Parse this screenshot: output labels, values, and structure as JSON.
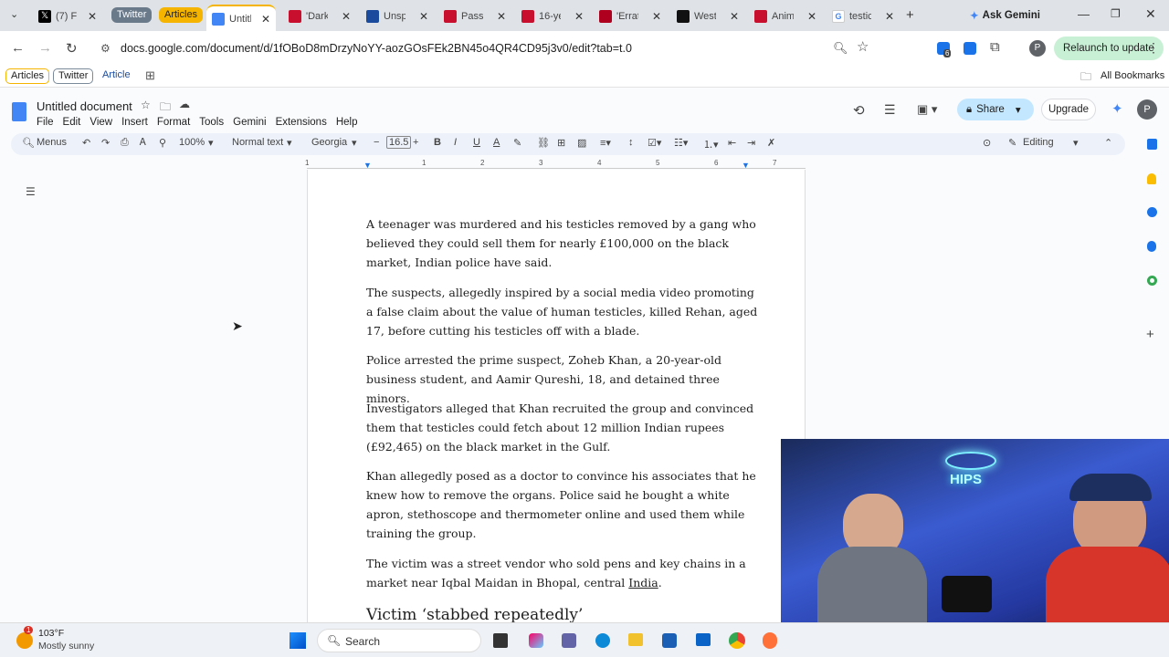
{
  "tabs": [
    {
      "title": "(7) Fr",
      "color": "#000000"
    },
    {
      "title": "Untitl",
      "color": "#4285f4",
      "active": true
    },
    {
      "title": "'Dark",
      "color": "#c8102e"
    },
    {
      "title": "Unsp",
      "color": "#1a4b9c"
    },
    {
      "title": "Passe",
      "color": "#c8102e"
    },
    {
      "title": "16-ye",
      "color": "#c8102e"
    },
    {
      "title": "'Errat",
      "color": "#b00020"
    },
    {
      "title": "West",
      "color": "#111111"
    },
    {
      "title": "Anim",
      "color": "#c8102e"
    },
    {
      "title": "testic",
      "color": "#ffffff"
    }
  ],
  "tab_groups": {
    "twitter": "Twitter",
    "articles": "Articles"
  },
  "ask_gemini": "Ask Gemini",
  "url": "docs.google.com/document/d/1fOBoD8mDrzyNoYY-aozGOsFEk2BN45o4QR4CD95j3v0/edit?tab=t.0",
  "extension_badge": "6",
  "relaunch": "Relaunch to update",
  "bookmarks": {
    "articles": "Articles",
    "twitter": "Twitter",
    "article": "Article",
    "all": "All Bookmarks"
  },
  "doc": {
    "title": "Untitled document",
    "menus": [
      "File",
      "Edit",
      "View",
      "Insert",
      "Format",
      "Tools",
      "Gemini",
      "Extensions",
      "Help"
    ],
    "share": "Share",
    "upgrade": "Upgrade",
    "avatar": "P"
  },
  "toolbar": {
    "menus": "Menus",
    "zoom": "100%",
    "style": "Normal text",
    "font": "Georgia",
    "font_size": "16.5",
    "mode": "Editing"
  },
  "ruler": [
    "1",
    "1",
    "2",
    "3",
    "4",
    "5",
    "6",
    "7"
  ],
  "paragraphs": [
    "A teenager was murdered and his testicles removed by a gang who believed they could sell them for nearly £100,000 on the black market, Indian police have said.",
    "The suspects, allegedly inspired by a social media video promoting a false claim about the value of human testicles, killed Rehan, aged 17, before cutting his testicles off with a blade.",
    "Police arrested the prime suspect, Zoheb Khan, a 20-year-old business student, and Aamir Qureshi, 18, and detained three minors.",
    "Investigators alleged that Khan recruited the group and convinced them that testicles could fetch about 12 million Indian rupees (£92,465) on the black market in the Gulf.",
    "Khan allegedly posed as a doctor to convince his associates that he knew how to remove the organs. Police said he bought a white apron, stethoscope and thermometer online and used them while training the group."
  ],
  "para6_text": "The victim was a street vendor who sold pens and key chains in a market near Iqbal Maidan in Bhopal, central ",
  "para6_link": "India",
  "para6_end": ".",
  "heading": "Victim ‘stabbed repeatedly’",
  "weather": {
    "temp": "103°F",
    "desc": "Mostly sunny",
    "badge": "1"
  },
  "taskbar_search": "Search",
  "webcam_sign": "HIPS"
}
